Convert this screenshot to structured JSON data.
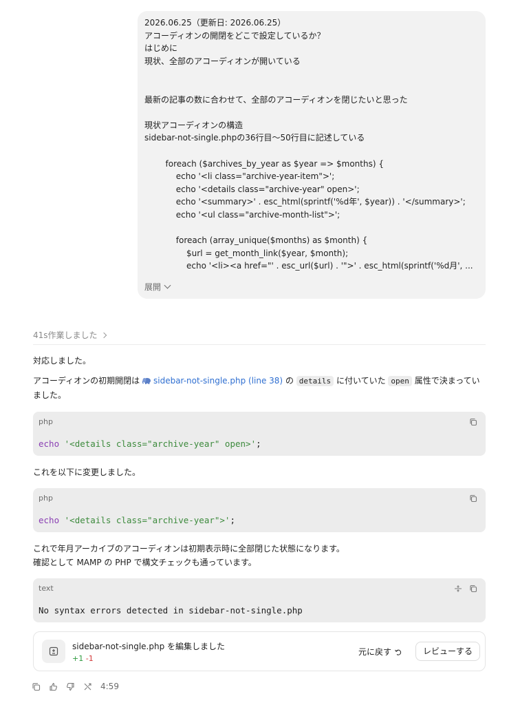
{
  "message": {
    "lines": [
      "2026.06.25（更新日: 2026.06.25）",
      "アコーディオンの開閉をどこで設定しているか？",
      "はじめに",
      "現状、全部のアコーディオンが開いている",
      "",
      "",
      "最新の記事の数に合わせて、全部のアコーディオンを閉じたいと思った",
      "",
      "現状アコーディオンの構造",
      "sidebar-not-single.phpの36行目〜50行目に記述している",
      "",
      "        foreach ($archives_by_year as $year => $months) {",
      "            echo '<li class=\"archive-year-item\">';",
      "            echo '<details class=\"archive-year\" open>';",
      "            echo '<summary>' . esc_html(sprintf('%d年', $year)) . '</summary>';",
      "            echo '<ul class=\"archive-month-list\">';",
      "",
      "            foreach (array_unique($months) as $month) {",
      "                $url = get_month_link($year, $month);",
      "                echo '<li><a href=\"' . esc_url($url) . '\">' . esc_html(sprintf('%d月', ..."
    ],
    "expand_label": "展開"
  },
  "worked_label": "41s作業しました",
  "reply": {
    "p1": "対応しました。",
    "p2_before": "アコーディオンの初期開閉は ",
    "p2_link": "sidebar-not-single.php (line 38)",
    "p2_mid1": " の ",
    "p2_code1": "details",
    "p2_mid2": " に付いていた ",
    "p2_code2": "open",
    "p2_after": " 属性で決まっていました。",
    "code1": {
      "lang": "php",
      "keyword": "echo",
      "string": "'<details class=\"archive-year\" open>'",
      "end": ";"
    },
    "p3": "これを以下に変更しました。",
    "code2": {
      "lang": "php",
      "keyword": "echo",
      "string": "'<details class=\"archive-year\">'",
      "end": ";"
    },
    "p4_line1": "これで年月アーカイブのアコーディオンは初期表示時に全部閉じた状態になります。",
    "p4_line2": "確認として MAMP の PHP で構文チェックも通っています。",
    "code3": {
      "lang": "text",
      "text": "No syntax errors detected in sidebar-not-single.php"
    }
  },
  "edit_card": {
    "title": "sidebar-not-single.php を編集しました",
    "added": "+1",
    "removed": "-1",
    "undo_label": "元に戻す",
    "review_label": "レビューする"
  },
  "footer": {
    "time": "4:59"
  }
}
